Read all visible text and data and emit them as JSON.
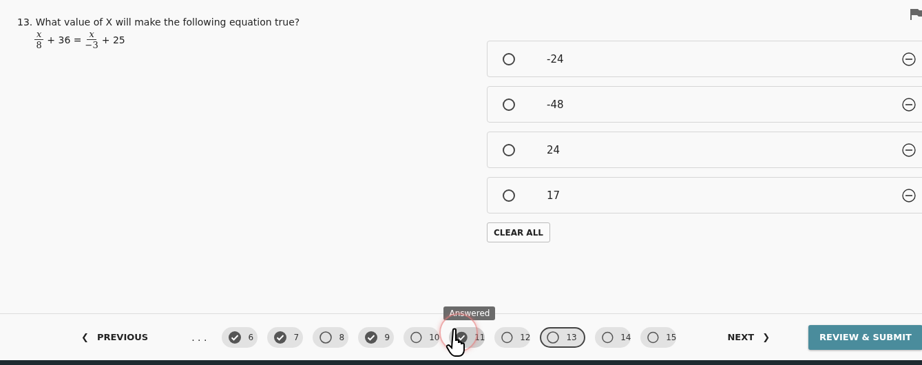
{
  "question": {
    "number": "13.",
    "text": "What value of X will make the following equation true?",
    "equation": [
      {
        "kind": "fraction",
        "numerator": "x",
        "denominator": "8"
      },
      {
        "kind": "text",
        "text": "+ 36 ="
      },
      {
        "kind": "fraction",
        "numerator": "x",
        "denominator": "−3"
      },
      {
        "kind": "text",
        "text": "+ 25"
      }
    ]
  },
  "flagged": false,
  "options": [
    {
      "label": "-24",
      "selected": false
    },
    {
      "label": "-48",
      "selected": false
    },
    {
      "label": "24",
      "selected": false
    },
    {
      "label": "17",
      "selected": false
    }
  ],
  "clear_button": "CLEAR ALL",
  "footer": {
    "previous": {
      "icon": "❮",
      "label": "PREVIOUS"
    },
    "ellipsis": ". . .",
    "pages": [
      {
        "label": "6",
        "answered": true,
        "selected": false,
        "hovered": false
      },
      {
        "label": "7",
        "answered": true,
        "selected": false,
        "hovered": false
      },
      {
        "label": "8",
        "answered": false,
        "selected": false,
        "hovered": false
      },
      {
        "label": "9",
        "answered": true,
        "selected": false,
        "hovered": false
      },
      {
        "label": "10",
        "answered": false,
        "selected": false,
        "hovered": false
      },
      {
        "label": "11",
        "answered": true,
        "selected": false,
        "hovered": true,
        "tooltip": "Answered"
      },
      {
        "label": "12",
        "answered": false,
        "selected": false,
        "hovered": false
      },
      {
        "label": "13",
        "answered": false,
        "selected": true,
        "hovered": false
      },
      {
        "label": "14",
        "answered": false,
        "selected": false,
        "hovered": false
      },
      {
        "label": "15",
        "answered": false,
        "selected": false,
        "hovered": false
      }
    ],
    "next": {
      "label": "NEXT",
      "icon": "❯"
    },
    "submit": "REVIEW & SUBMIT"
  }
}
